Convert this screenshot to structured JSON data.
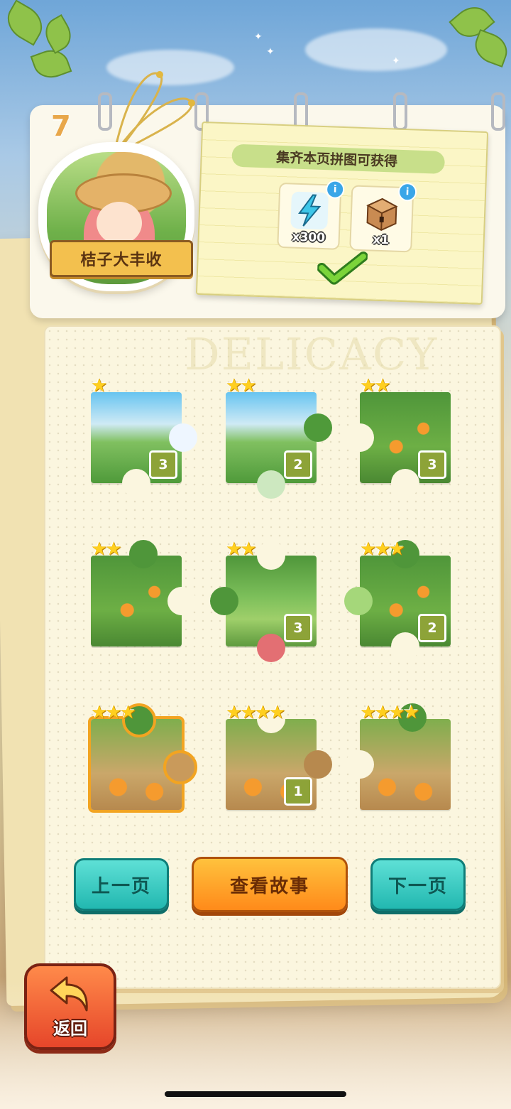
{
  "chapter": {
    "number": "7",
    "title": "桔子大丰收"
  },
  "reward": {
    "title": "集齐本页拼图可获得",
    "items": [
      {
        "icon": "lightning-energy-icon",
        "qty": "x300",
        "info": "i"
      },
      {
        "icon": "wooden-chest-icon",
        "qty": "x1",
        "info": "i"
      }
    ],
    "claimed_icon": "checkmark-icon"
  },
  "watermark": "DELICACY",
  "puzzles": [
    {
      "stars": 1,
      "count": "3"
    },
    {
      "stars": 2,
      "count": "2"
    },
    {
      "stars": 2,
      "count": "3"
    },
    {
      "stars": 2,
      "count": ""
    },
    {
      "stars": 2,
      "count": "3"
    },
    {
      "stars": 3,
      "count": "2"
    },
    {
      "stars": 3,
      "count": ""
    },
    {
      "stars": 4,
      "count": "1"
    },
    {
      "stars": 4,
      "count": ""
    }
  ],
  "nav": {
    "prev": "上一页",
    "story": "查看故事",
    "next": "下一页"
  },
  "back": {
    "label": "返回"
  },
  "colors": {
    "accent_orange": "#ff8a1a",
    "accent_teal": "#22b8b0",
    "count_green": "#8da338",
    "star_gold": "#ffcf1f"
  }
}
